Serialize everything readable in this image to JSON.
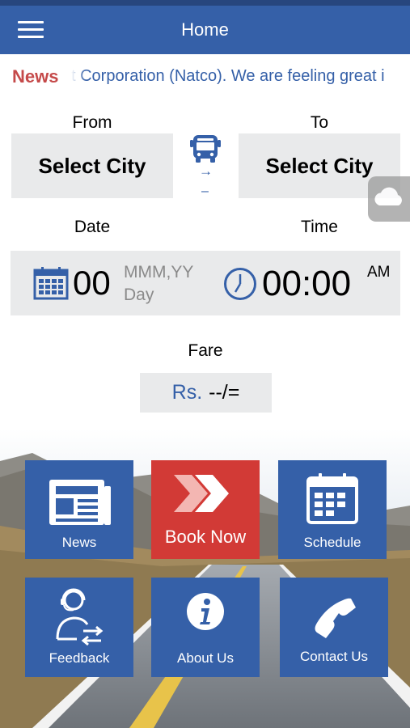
{
  "header": {
    "title": "Home"
  },
  "news": {
    "label": "News",
    "ticker": "t Corporation (Natco). We are feeling great i"
  },
  "route": {
    "from_label": "From",
    "to_label": "To",
    "from_value": "Select City",
    "to_value": "Select City",
    "arrow": "→",
    "dash": "–"
  },
  "datetime": {
    "date_label": "Date",
    "time_label": "Time",
    "day": "00",
    "month_year": "MMM,YY",
    "weekday": "Day",
    "time": "00:00",
    "ampm": "AM"
  },
  "fare": {
    "label": "Fare",
    "currency": "Rs.",
    "value": "--/="
  },
  "tiles": {
    "news": "News",
    "book_now": "Book Now",
    "schedule": "Schedule",
    "feedback": "Feedback",
    "about_us": "About Us",
    "contact_us": "Contact Us"
  },
  "colors": {
    "brand_blue": "#3560a8",
    "book_red": "#d23a36",
    "news_red": "#c54a4a",
    "panel_gray": "#e9eaeb"
  }
}
